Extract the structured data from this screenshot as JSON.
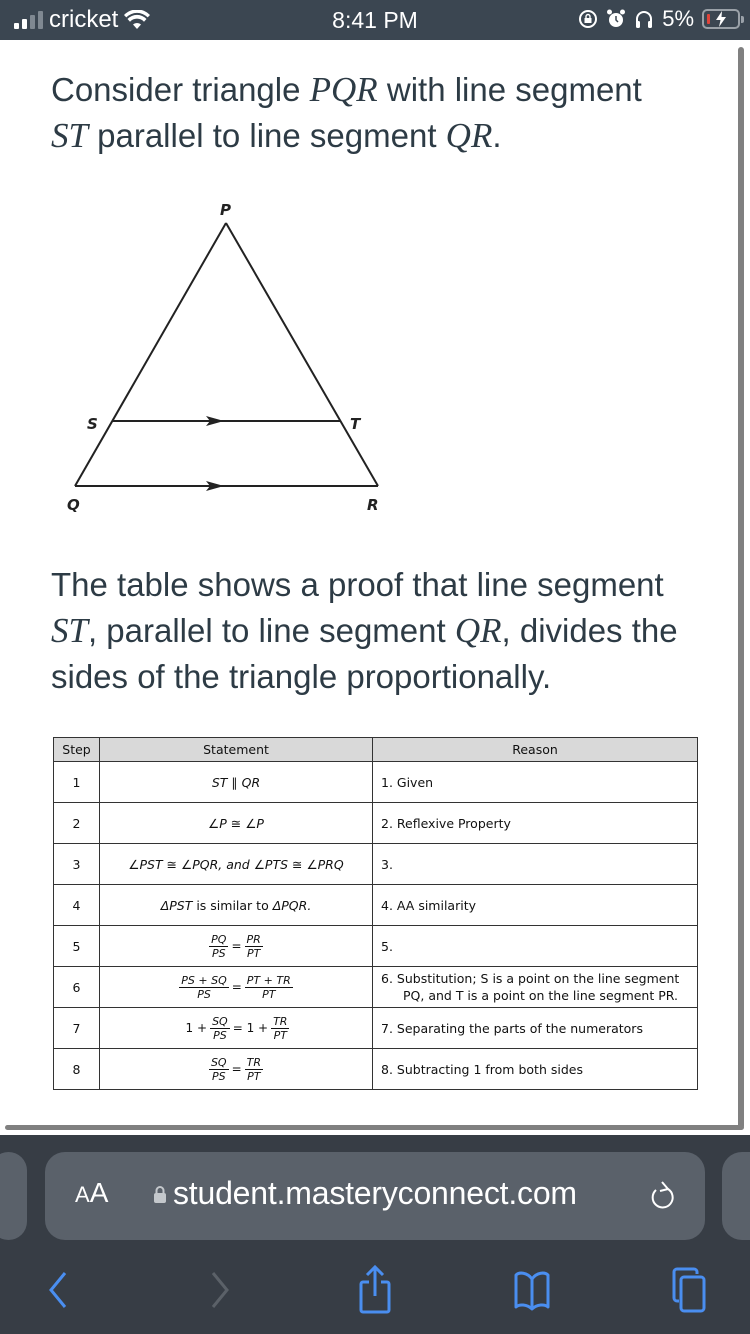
{
  "status_bar": {
    "carrier": "cricket",
    "time": "8:41 PM",
    "battery_percent": "5%",
    "battery_level": 0.05,
    "icons": [
      "signal-icon",
      "wifi-icon",
      "rotation-lock-icon",
      "alarm-icon",
      "headphones-icon",
      "battery-charging-icon"
    ]
  },
  "question": {
    "intro": {
      "t1": "Consider triangle ",
      "m1": "PQR",
      "t2": " with line segment ",
      "m2": "ST",
      "t3": " parallel to line segment ",
      "m3": "QR",
      "t4": "."
    },
    "diagram": {
      "labels": {
        "P": "P",
        "Q": "Q",
        "R": "R",
        "S": "S",
        "T": "T"
      }
    },
    "description": {
      "t1": "The table shows a proof that line segment ",
      "m1": "ST",
      "t2": ", parallel to line segment ",
      "m2": "QR",
      "t3": ", divides the sides of the triangle proportionally."
    }
  },
  "proof_table": {
    "headers": {
      "step": "Step",
      "statement": "Statement",
      "reason": "Reason"
    },
    "rows": [
      {
        "step": "1",
        "statement": "ST ∥ QR",
        "reason": "1. Given"
      },
      {
        "step": "2",
        "statement": "∠P ≅ ∠P",
        "reason": "2. Reflexive Property"
      },
      {
        "step": "3",
        "statement": "∠PST ≅ ∠PQR, and ∠PTS ≅ ∠PRQ",
        "reason": "3."
      },
      {
        "step": "4",
        "statement_a": "ΔPST",
        "statement_b": " is similar to ",
        "statement_c": "ΔPQR.",
        "reason": "4. AA similarity"
      },
      {
        "step": "5",
        "lhs_num": "PQ",
        "lhs_den": "PS",
        "eq": "=",
        "rhs_num": "PR",
        "rhs_den": "PT",
        "reason": "5."
      },
      {
        "step": "6",
        "lhs_num": "PS + SQ",
        "lhs_den": "PS",
        "eq": "=",
        "rhs_num": "PT + TR",
        "rhs_den": "PT",
        "reason_line1": "6. Substitution;  S is a point on the line segment",
        "reason_line2": "PQ, and T is a point on the line segment PR."
      },
      {
        "step": "7",
        "lhs_pre": "1 +",
        "lhs_num": "SQ",
        "lhs_den": "PS",
        "eq": "= 1 +",
        "rhs_num": "TR",
        "rhs_den": "PT",
        "reason": "7. Separating the parts of the numerators"
      },
      {
        "step": "8",
        "lhs_num": "SQ",
        "lhs_den": "PS",
        "eq": "=",
        "rhs_num": "TR",
        "rhs_den": "PT",
        "reason": "8. Subtracting 1 from both sides"
      }
    ]
  },
  "browser": {
    "text_size_button": "AA",
    "url": "student.masteryconnect.com",
    "toolbar": [
      "back",
      "forward",
      "share",
      "bookmarks",
      "tabs"
    ]
  },
  "colors": {
    "status_bar_bg": "#3b4651",
    "text": "#2d3b45",
    "browser_bg": "#373d45",
    "url_bar_bg": "#5a616a",
    "accent_blue": "#4a8ef0",
    "table_header_bg": "#d9d9d9"
  }
}
